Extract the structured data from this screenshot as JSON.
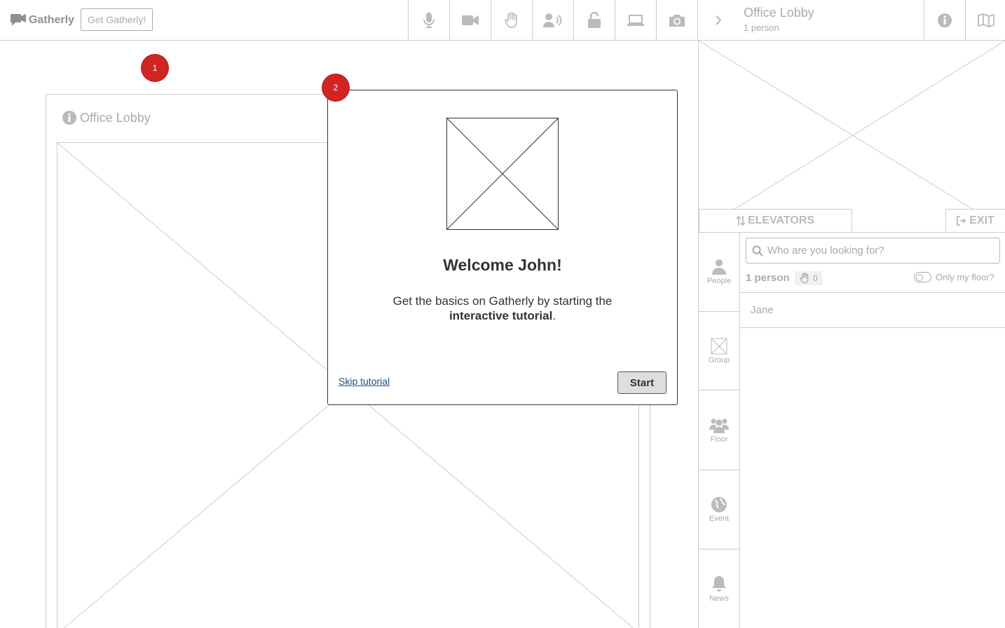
{
  "app": {
    "name": "Gatherly",
    "cta_label": "Get Gatherly!"
  },
  "toolbar": {
    "tools": [
      "microphone-icon",
      "video-camera-icon",
      "raise-hand-icon",
      "broadcast-icon",
      "unlock-icon",
      "laptop-icon",
      "camera-icon",
      "chevron-right-icon"
    ]
  },
  "room": {
    "title": "Office Lobby",
    "count_label": "1 person"
  },
  "stage": {
    "title": "Office Lobby"
  },
  "badges": [
    "1",
    "2"
  ],
  "panel": {
    "elevators_label": "ELEVATORS",
    "exit_label": "EXIT",
    "side_tabs": [
      {
        "label": "People",
        "icon": "person-icon"
      },
      {
        "label": "Group",
        "icon": "group-placeholder-icon"
      },
      {
        "label": "Floor",
        "icon": "users-icon"
      },
      {
        "label": "Event",
        "icon": "globe-icon"
      },
      {
        "label": "News",
        "icon": "bell-icon"
      }
    ],
    "search_placeholder": "Who are you looking for?",
    "people_count": "1 person",
    "hand_count": "0",
    "floor_toggle_label": "Only my floor?",
    "people": [
      "Jane"
    ]
  },
  "modal": {
    "title": "Welcome John!",
    "body_prefix": "Get the basics on Gatherly by starting the ",
    "body_bold": "interactive tutorial",
    "body_suffix": ".",
    "skip_label": "Skip tutorial",
    "start_label": "Start"
  },
  "colors": {
    "badge": "#d32424",
    "link": "#1f4e79",
    "wire": "#cccccc"
  }
}
